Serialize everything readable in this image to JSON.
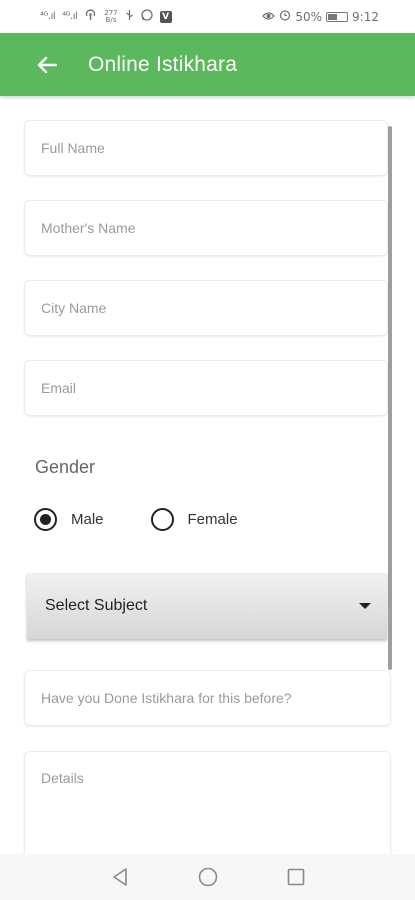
{
  "status_bar": {
    "signal1": "⁴ᴳ.ıl",
    "signal2": "⁴ᴳ.ıl",
    "speed_top": "277",
    "speed_bottom": "B/s",
    "battery_percent": "50%",
    "time": "9:12",
    "icons": [
      "signal-icon",
      "signal-icon",
      "hotspot-icon",
      "usb-icon",
      "whatsapp-icon",
      "v-app-icon",
      "eye-icon",
      "alarm-icon",
      "battery-icon"
    ]
  },
  "app_bar": {
    "title": "Online Istikhara",
    "background": "#5cb85c",
    "back_icon": "arrow-left-icon"
  },
  "form": {
    "full_name": {
      "placeholder": "Full Name",
      "value": ""
    },
    "mother_name": {
      "placeholder": "Mother's Name",
      "value": ""
    },
    "city_name": {
      "placeholder": "City Name",
      "value": ""
    },
    "email": {
      "placeholder": "Email",
      "value": ""
    },
    "gender": {
      "label": "Gender",
      "options": [
        {
          "label": "Male",
          "checked": true
        },
        {
          "label": "Female",
          "checked": false
        }
      ]
    },
    "subject": {
      "selected": "Select Subject"
    },
    "done_before": {
      "placeholder": "Have you Done Istikhara for this before?",
      "value": ""
    },
    "details": {
      "placeholder": "Details",
      "value": ""
    }
  },
  "nav_bar": {
    "icons": [
      "back-triangle-icon",
      "home-circle-icon",
      "recents-square-icon"
    ]
  }
}
